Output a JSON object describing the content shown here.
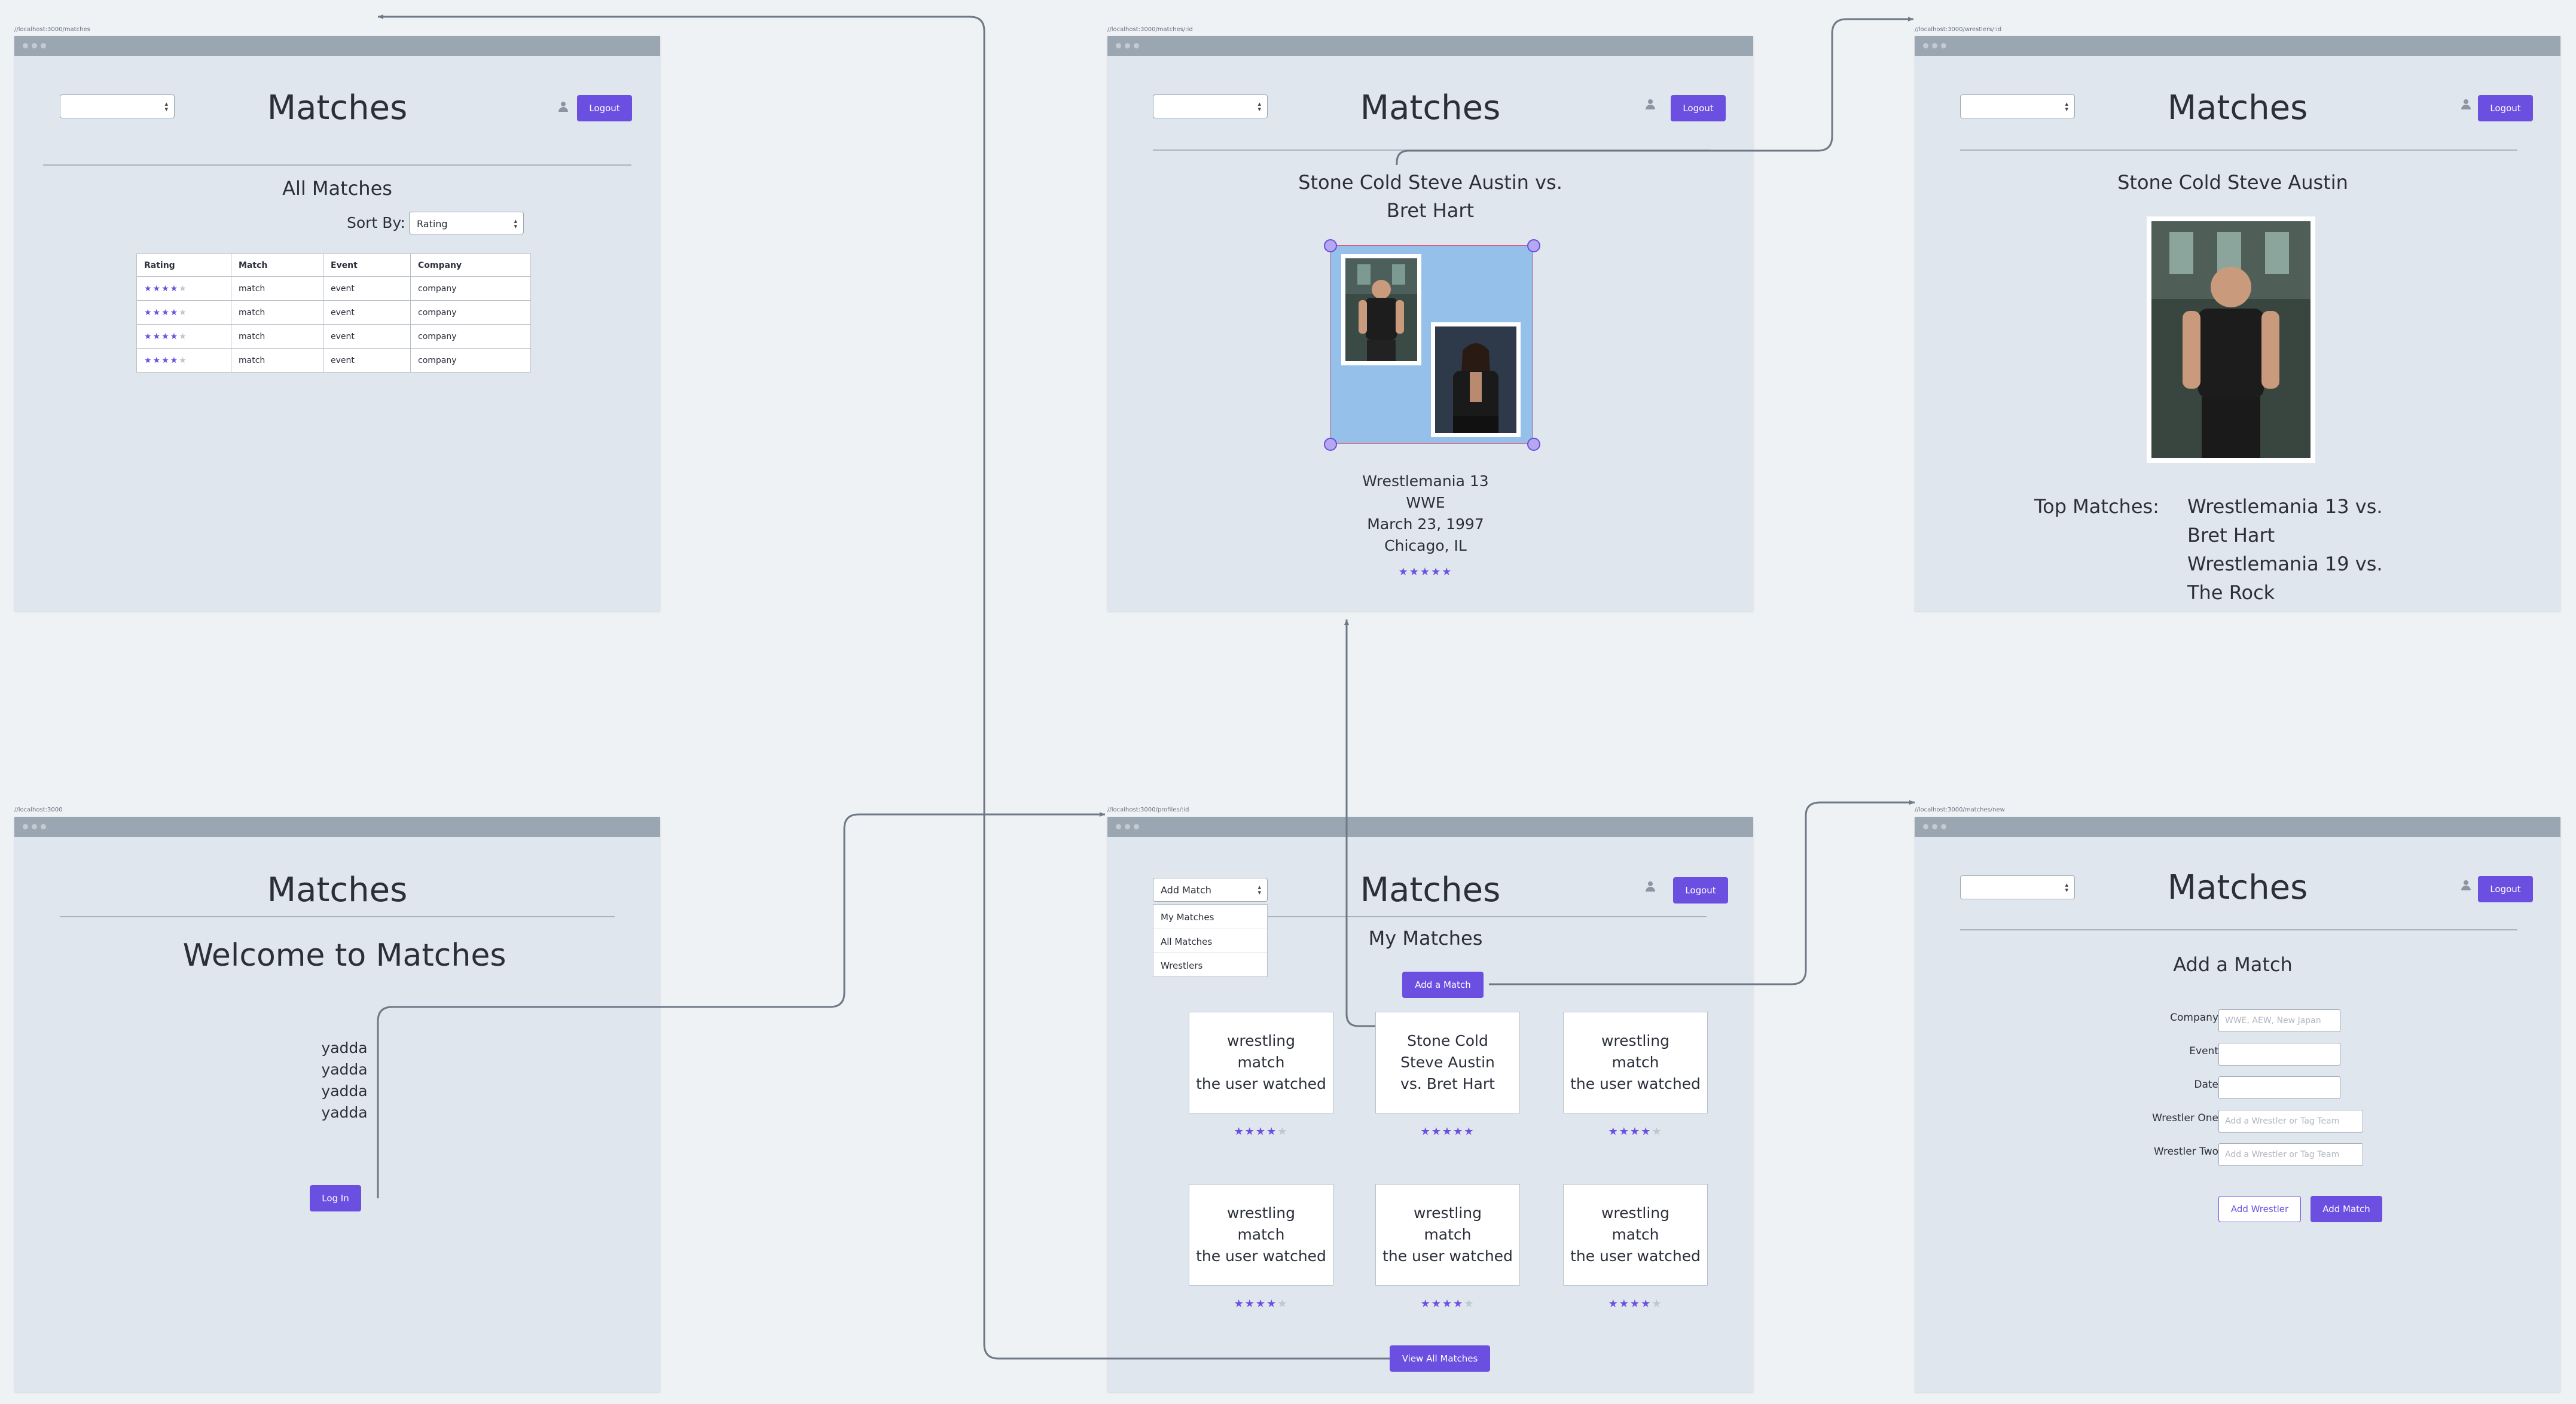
{
  "app_title": "Matches",
  "logout_label": "Logout",
  "screens": {
    "all_matches": {
      "url": "//localhost:3000/matches",
      "heading": "All Matches",
      "sort_label": "Sort By:",
      "sort_value": "Rating",
      "columns": [
        "Rating",
        "Match",
        "Event",
        "Company"
      ],
      "rows": [
        {
          "rating": 4,
          "match": "match",
          "event": "event",
          "company": "company"
        },
        {
          "rating": 4,
          "match": "match",
          "event": "event",
          "company": "company"
        },
        {
          "rating": 4,
          "match": "match",
          "event": "event",
          "company": "company"
        },
        {
          "rating": 4,
          "match": "match",
          "event": "event",
          "company": "company"
        }
      ]
    },
    "match_detail": {
      "url": "//localhost:3000/matches/:id",
      "match_line1": "Stone Cold Steve Austin vs.",
      "match_line2": "Bret Hart",
      "event": "Wrestlemania 13",
      "company": "WWE",
      "date": "March 23, 1997",
      "location": "Chicago, IL",
      "rating": 5
    },
    "wrestler_detail": {
      "url": "//localhost:3000/wrestlers/:id",
      "name": "Stone Cold Steve Austin",
      "top_matches_label": "Top Matches:",
      "top_matches": [
        "Wrestlemania 13 vs.",
        "Bret Hart",
        "Wrestlemania 19 vs.",
        "The Rock"
      ]
    },
    "welcome": {
      "url": "//localhost:3000",
      "heading": "Welcome to Matches",
      "body_lines": [
        "yadda",
        "yadda",
        "yadda",
        "yadda"
      ],
      "login_label": "Log In"
    },
    "profile": {
      "url": "//localhost:3000/profiles/:id",
      "dropdown_value": "Add Match",
      "dropdown_options": [
        "My Matches",
        "All Matches",
        "Wrestlers"
      ],
      "heading": "My Matches",
      "add_match_label": "Add a Match",
      "view_all_label": "View All Matches",
      "cards": [
        {
          "line1": "wrestling",
          "line2": "match",
          "line3": "the user watched",
          "rating": 4
        },
        {
          "line1": "Stone Cold",
          "line2": "Steve Austin",
          "line3": "vs. Bret Hart",
          "rating": 5
        },
        {
          "line1": "wrestling",
          "line2": "match",
          "line3": "the user watched",
          "rating": 4
        },
        {
          "line1": "wrestling",
          "line2": "match",
          "line3": "the user watched",
          "rating": 4
        },
        {
          "line1": "wrestling",
          "line2": "match",
          "line3": "the user watched",
          "rating": 4
        },
        {
          "line1": "wrestling",
          "line2": "match",
          "line3": "the user watched",
          "rating": 4
        }
      ]
    },
    "new_match": {
      "url": "//localhost:3000/matches/new",
      "heading": "Add a Match",
      "fields": [
        {
          "label": "Company",
          "placeholder": "WWE, AEW, New Japan"
        },
        {
          "label": "Event",
          "placeholder": ""
        },
        {
          "label": "Date",
          "placeholder": ""
        },
        {
          "label": "Wrestler One",
          "placeholder": "Add a Wrestler or Tag Team"
        },
        {
          "label": "Wrestler Two",
          "placeholder": "Add a Wrestler or Tag Team"
        }
      ],
      "add_wrestler_label": "Add Wrestler",
      "add_match_label": "Add Match"
    }
  },
  "colors": {
    "accent": "#6b4fe0",
    "frame": "#e0e6ee",
    "chrome": "#9aa6b2",
    "star_on": "#6b4fe0",
    "star_off": "#c0c6d0",
    "arrow": "#6e7886",
    "image_bg": "#95c0e9"
  }
}
